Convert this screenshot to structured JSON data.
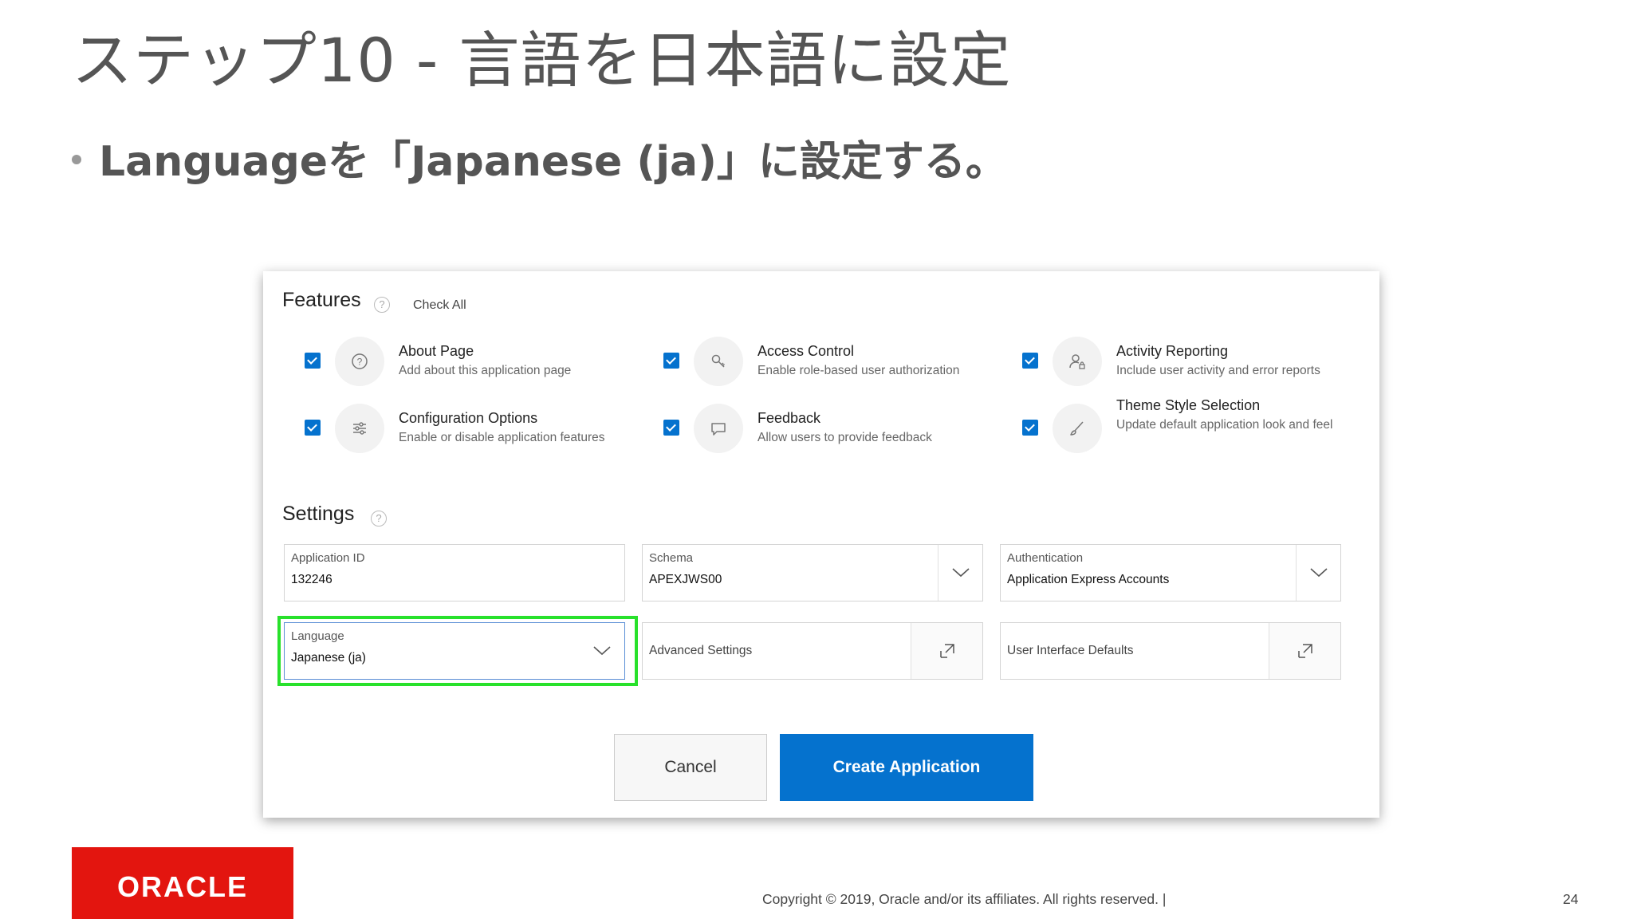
{
  "slide": {
    "title": "ステップ10 - 言語を日本語に設定",
    "bullet": "Languageを「Japanese (ja)」に設定する。"
  },
  "features": {
    "title": "Features",
    "help": "?",
    "check_all": "Check All",
    "items": [
      {
        "name": "About Page",
        "desc": "Add about this application page",
        "icon": "help-circle-icon",
        "checked": true
      },
      {
        "name": "Access Control",
        "desc": "Enable role-based user authorization",
        "icon": "key-icon",
        "checked": true
      },
      {
        "name": "Activity Reporting",
        "desc": "Include user activity and error reports",
        "icon": "user-lock-icon",
        "checked": true
      },
      {
        "name": "Configuration Options",
        "desc": "Enable or disable application features",
        "icon": "sliders-icon",
        "checked": true
      },
      {
        "name": "Feedback",
        "desc": "Allow users to provide feedback",
        "icon": "speech-bubble-icon",
        "checked": true
      },
      {
        "name": "Theme Style Selection",
        "desc": "Update default application look and feel",
        "icon": "brush-icon",
        "checked": true
      }
    ]
  },
  "settings": {
    "title": "Settings",
    "help": "?",
    "application_id": {
      "label": "Application ID",
      "value": "132246"
    },
    "schema": {
      "label": "Schema",
      "value": "APEXJWS00"
    },
    "authentication": {
      "label": "Authentication",
      "value": "Application Express Accounts"
    },
    "language": {
      "label": "Language",
      "value": "Japanese (ja)"
    },
    "advanced_settings": {
      "label": "Advanced Settings"
    },
    "ui_defaults": {
      "label": "User Interface Defaults"
    }
  },
  "buttons": {
    "cancel": "Cancel",
    "create": "Create Application"
  },
  "footer": {
    "logo": "ORACLE",
    "copyright": "Copyright © 2019, Oracle and/or its affiliates. All rights reserved.  |",
    "page_number": "24"
  },
  "colors": {
    "accent": "#0572ce",
    "highlight": "#28e12b",
    "oracle_red": "#e3150f"
  }
}
